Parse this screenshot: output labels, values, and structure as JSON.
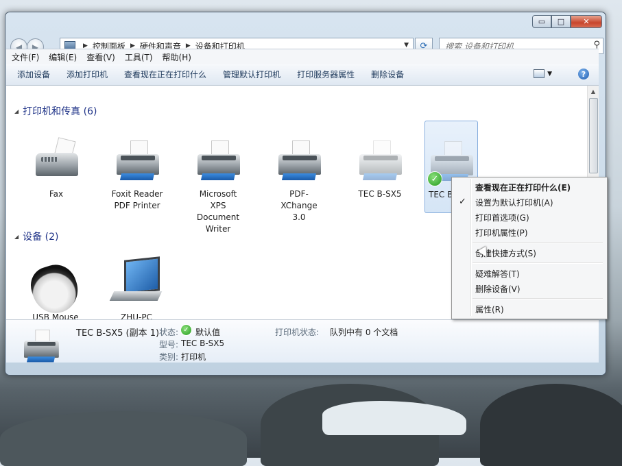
{
  "window": {
    "controls": {
      "minimize": "▭",
      "maximize": "□",
      "close": "✕"
    }
  },
  "nav": {
    "breadcrumbs": [
      "控制面板",
      "硬件和声音",
      "设备和打印机"
    ],
    "search_placeholder": "搜索 设备和打印机"
  },
  "menu": [
    "文件(F)",
    "编辑(E)",
    "查看(V)",
    "工具(T)",
    "帮助(H)"
  ],
  "commands": [
    "添加设备",
    "添加打印机",
    "查看现在正在打印什么",
    "管理默认打印机",
    "打印服务器属性",
    "删除设备"
  ],
  "groups": {
    "printers": "打印机和传真 (6)",
    "devices": "设备 (2)"
  },
  "printers": [
    {
      "label": "Fax",
      "icon": "fax-icon"
    },
    {
      "label": "Foxit Reader PDF Printer",
      "icon": "printer-icon"
    },
    {
      "label": "Microsoft XPS Document Writer",
      "icon": "printer-icon"
    },
    {
      "label": "PDF-XChange 3.0",
      "icon": "printer-icon"
    },
    {
      "label": "TEC B-SX5",
      "icon": "printer-icon"
    },
    {
      "label": "TEC B",
      "icon": "printer-icon",
      "selected": true,
      "default": true
    }
  ],
  "devices": [
    {
      "label": "USB Mouse",
      "icon": "mouse-icon"
    },
    {
      "label": "ZHU-PC",
      "icon": "laptop-icon"
    }
  ],
  "details": {
    "name": "TEC B-SX5 (副本 1)",
    "status_label": "状态:",
    "status_value": "默认值",
    "model_label": "型号:",
    "model_value": "TEC B-SX5",
    "category_label": "类别:",
    "category_value": "打印机",
    "printer_status_label": "打印机状态:",
    "printer_status_value": "队列中有 0 个文档"
  },
  "context_menu": [
    {
      "label": "查看现在正在打印什么(E)",
      "bold": true
    },
    {
      "label": "设置为默认打印机(A)",
      "checked": true
    },
    {
      "label": "打印首选项(G)"
    },
    {
      "label": "打印机属性(P)"
    },
    {
      "label": "创建快捷方式(S)"
    },
    {
      "label": "疑难解答(T)"
    },
    {
      "label": "删除设备(V)"
    },
    {
      "label": "属性(R)"
    }
  ],
  "colors": {
    "group_header": "#1e3287",
    "selection_border": "#84acdd",
    "default_check": "#239a1e"
  }
}
